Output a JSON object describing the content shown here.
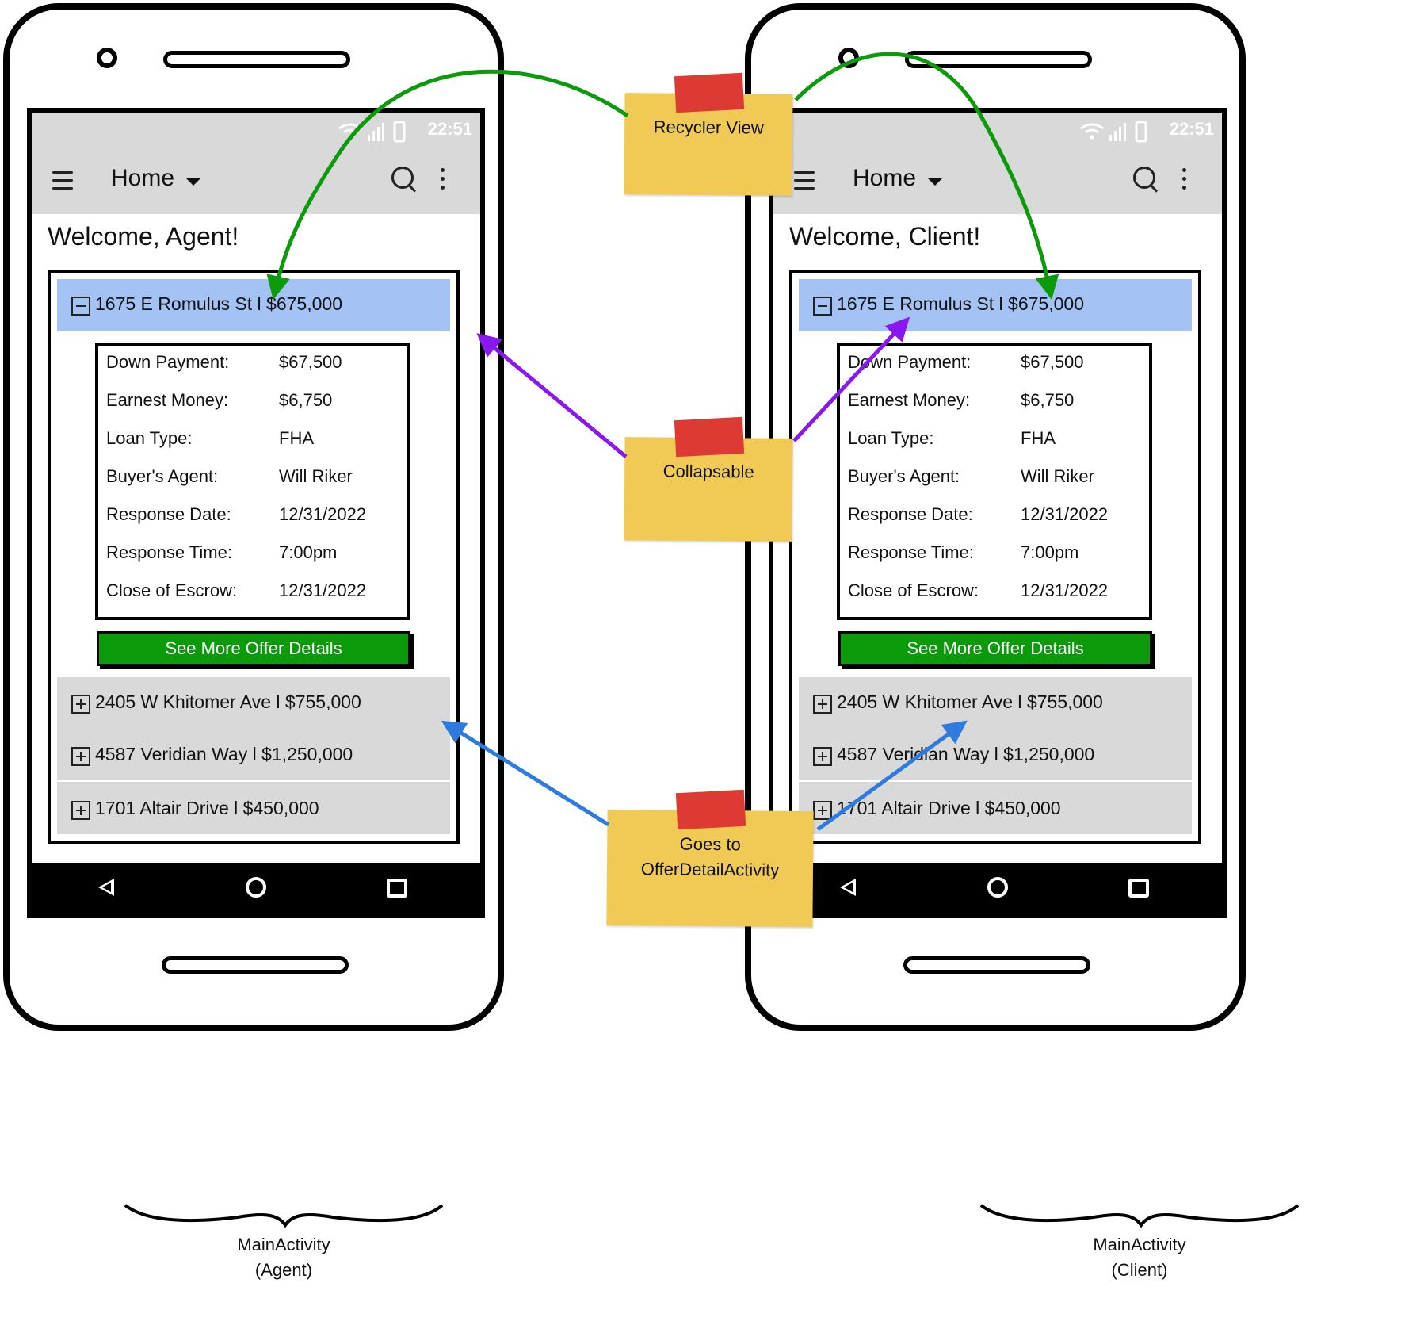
{
  "colors": {
    "selected_row": "#a4c2f4",
    "button_green": "#0a9a0a",
    "sticky_yellow": "#f1ca55",
    "tape_red": "#dd3a33",
    "arrow_green": "#0a9a0a",
    "arrow_purple": "#8a17f0",
    "arrow_blue": "#2e7be0",
    "bars_gray": "#d9d9d9"
  },
  "phones": [
    {
      "status_time": "22:51",
      "appbar_title": "Home",
      "welcome": "Welcome, Agent!",
      "expanded_row": "1675 E Romulus St l $675,000",
      "details": [
        {
          "label": "Down Payment:",
          "value": "$67,500"
        },
        {
          "label": "Earnest Money:",
          "value": "$6,750"
        },
        {
          "label": "Loan Type:",
          "value": "FHA"
        },
        {
          "label": "Buyer's Agent:",
          "value": "Will Riker"
        },
        {
          "label": "Response Date:",
          "value": "12/31/2022"
        },
        {
          "label": "Response Time:",
          "value": "7:00pm"
        },
        {
          "label": "Close of Escrow:",
          "value": "12/31/2022"
        }
      ],
      "see_more_label": "See More Offer Details",
      "collapsed_rows": [
        "2405 W Khitomer Ave l $755,000",
        "4587 Veridian Way l $1,250,000",
        "1701  Altair Drive l $450,000"
      ],
      "caption_line1": "MainActivity",
      "caption_line2": "(Agent)"
    },
    {
      "status_time": "22:51",
      "appbar_title": "Home",
      "welcome": "Welcome, Client!",
      "expanded_row": "1675 E Romulus St l $675,000",
      "details": [
        {
          "label": "Down Payment:",
          "value": "$67,500"
        },
        {
          "label": "Earnest Money:",
          "value": "$6,750"
        },
        {
          "label": "Loan Type:",
          "value": "FHA"
        },
        {
          "label": "Buyer's Agent:",
          "value": "Will Riker"
        },
        {
          "label": "Response Date:",
          "value": "12/31/2022"
        },
        {
          "label": "Response Time:",
          "value": "7:00pm"
        },
        {
          "label": "Close of Escrow:",
          "value": "12/31/2022"
        }
      ],
      "see_more_label": "See More Offer Details",
      "collapsed_rows": [
        "2405 W Khitomer Ave l $755,000",
        "4587 Veridian Way l $1,250,000",
        "1701  Altair Drive l $450,000"
      ],
      "caption_line1": "MainActivity",
      "caption_line2": "(Client)"
    }
  ],
  "notes": {
    "recycler": "Recycler View",
    "collapsable": "Collapsable",
    "goes_to_line1": "Goes to",
    "goes_to_line2": "OfferDetailActivity"
  }
}
